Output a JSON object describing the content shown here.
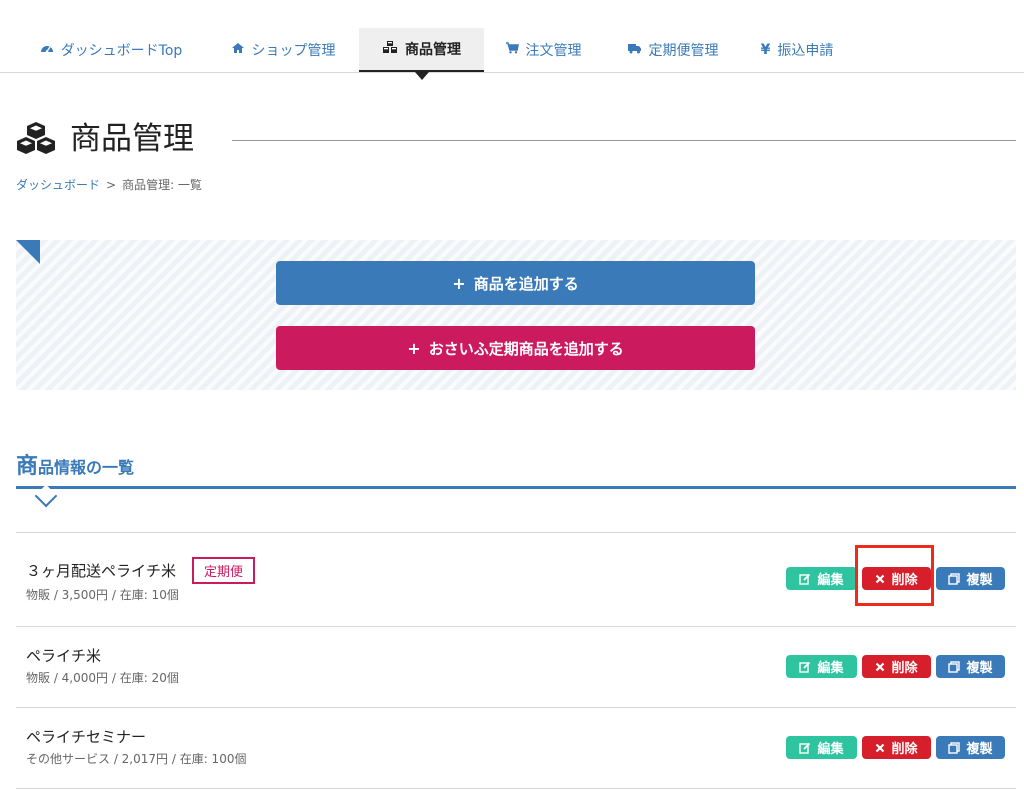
{
  "nav": {
    "tabs": [
      {
        "label": "ダッシュボードTop",
        "icon": "dashboard-icon"
      },
      {
        "label": "ショップ管理",
        "icon": "home-icon"
      },
      {
        "label": "商品管理",
        "icon": "cubes-icon",
        "active": true
      },
      {
        "label": "注文管理",
        "icon": "cart-icon"
      },
      {
        "label": "定期便管理",
        "icon": "truck-icon"
      },
      {
        "label": "振込申請",
        "icon": "yen-icon"
      }
    ]
  },
  "page": {
    "title": "商品管理",
    "title_icon": "cubes-icon",
    "breadcrumb": {
      "link": "ダッシュボード",
      "separator": ">",
      "current": "商品管理: 一覧"
    }
  },
  "actions": {
    "add_product": "商品を追加する",
    "add_furusato": "おさいふ定期商品を追加する",
    "plus_symbol": "+"
  },
  "section": {
    "title_first": "商",
    "title_rest": "品情報の一覧"
  },
  "products": [
    {
      "name": "３ヶ月配送ペライチ米",
      "badge": "定期便",
      "meta": "物販 / 3,500円 / 在庫: 10個"
    },
    {
      "name": "ペライチ米",
      "meta": "物販 / 4,000円 / 在庫: 20個"
    },
    {
      "name": "ペライチセミナー",
      "meta": "その他サービス / 2,017円 / 在庫: 100個"
    }
  ],
  "row_actions": {
    "edit": "編集",
    "delete": "削除",
    "copy": "複製"
  },
  "colors": {
    "accent_blue": "#3a7ab8",
    "accent_pink": "#cc1a5f",
    "edit_green": "#2ec4a0",
    "delete_red": "#d61f2b",
    "highlight": "#ee2a1a"
  }
}
